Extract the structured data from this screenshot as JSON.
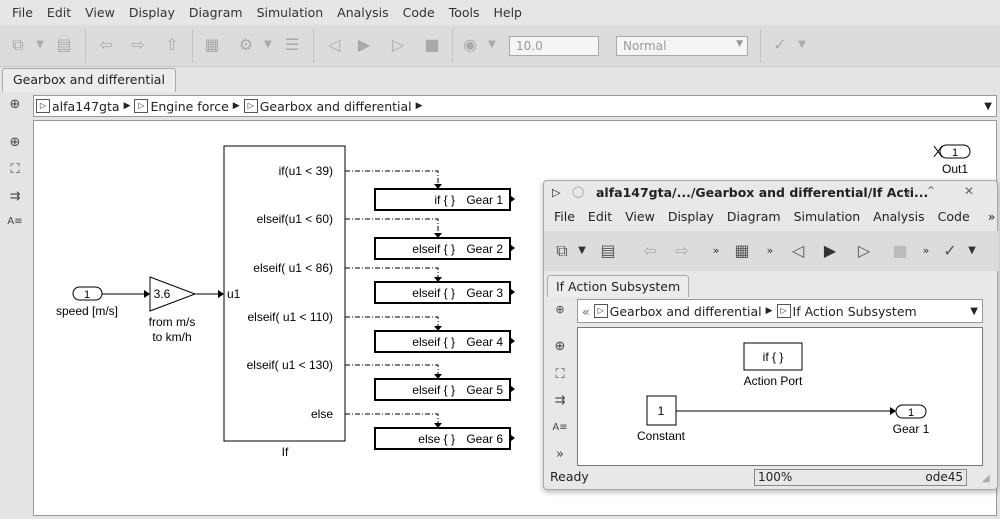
{
  "menu": [
    "File",
    "Edit",
    "View",
    "Display",
    "Diagram",
    "Simulation",
    "Analysis",
    "Code",
    "Tools",
    "Help"
  ],
  "toolbar": {
    "stop_time": "10.0",
    "sim_mode": "Normal"
  },
  "tab": "Gearbox and differential",
  "breadcrumb": [
    "alfa147gta",
    "Engine force",
    "Gearbox and differential"
  ],
  "diagram": {
    "inport": {
      "num": "1",
      "label": "speed [m/s]"
    },
    "gain": {
      "value": "3.6",
      "label1": "from m/s",
      "label2": "to km/h"
    },
    "if_block": {
      "name": "If",
      "input": "u1",
      "conditions": [
        "if(u1 < 39)",
        "elseif(u1 < 60)",
        "elseif( u1 < 86)",
        "elseif( u1 < 110)",
        "elseif( u1 < 130)",
        "else"
      ]
    },
    "actions": [
      {
        "kw": "if { }",
        "name": "Gear 1"
      },
      {
        "kw": "elseif { }",
        "name": "Gear 2"
      },
      {
        "kw": "elseif { }",
        "name": "Gear 3"
      },
      {
        "kw": "elseif { }",
        "name": "Gear 4"
      },
      {
        "kw": "elseif { }",
        "name": "Gear 5"
      },
      {
        "kw": "else { }",
        "name": "Gear 6"
      }
    ],
    "outport": {
      "num": "1",
      "label": "Out1"
    }
  },
  "subwindow": {
    "title": "alfa147gta/.../Gearbox and differential/If Acti...",
    "menu": [
      "File",
      "Edit",
      "View",
      "Display",
      "Diagram",
      "Simulation",
      "Analysis",
      "Code"
    ],
    "more": "»",
    "tab": "If Action Subsystem",
    "breadcrumb_prefix": "«",
    "breadcrumb": [
      "Gearbox and differential",
      "If Action Subsystem"
    ],
    "action_port": {
      "kw": "if { }",
      "label": "Action Port"
    },
    "constant": {
      "value": "1",
      "label": "Constant"
    },
    "outport": {
      "num": "1",
      "label": "Gear 1"
    },
    "status": "Ready",
    "zoom": "100%",
    "solver": "ode45"
  }
}
